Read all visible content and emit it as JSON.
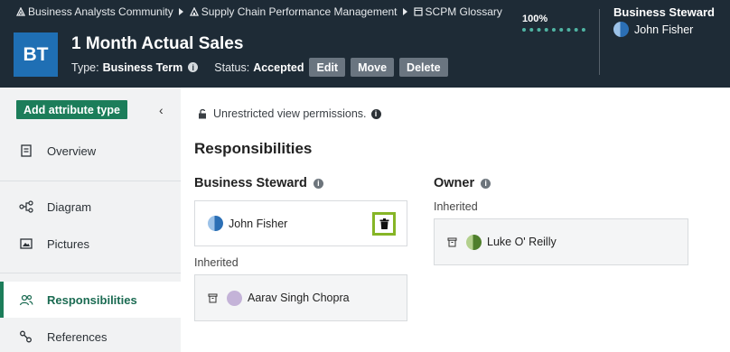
{
  "header": {
    "breadcrumbs": [
      {
        "label": "Business Analysts Community",
        "icon": "community-icon"
      },
      {
        "label": "Supply Chain Performance Management",
        "icon": "domain-icon"
      },
      {
        "label": "SCPM Glossary",
        "icon": "glossary-icon"
      }
    ],
    "asset_badge": "BT",
    "title": "1 Month Actual Sales",
    "type_label": "Type:",
    "type_value": "Business Term",
    "status_label": "Status:",
    "status_value": "Accepted",
    "buttons": {
      "edit": "Edit",
      "move": "Move",
      "delete": "Delete"
    },
    "progress": {
      "value": "100%",
      "fraction": 1.0
    },
    "steward": {
      "label": "Business Steward",
      "name": "John Fisher"
    }
  },
  "sidebar": {
    "add_attribute": "Add attribute type",
    "collapse_icon": "chevron-left-icon",
    "items": [
      {
        "label": "Overview",
        "icon": "overview-icon"
      },
      {
        "label": "Diagram",
        "icon": "diagram-icon"
      },
      {
        "label": "Pictures",
        "icon": "pictures-icon"
      },
      {
        "label": "Responsibilities",
        "icon": "people-icon",
        "active": true
      },
      {
        "label": "References",
        "icon": "references-icon"
      }
    ]
  },
  "main": {
    "permissions_text": "Unrestricted view permissions.",
    "section_title": "Responsibilities",
    "business_steward": {
      "title": "Business Steward",
      "assigned": "John Fisher",
      "inherited_label": "Inherited",
      "inherited": "Aarav Singh Chopra"
    },
    "owner": {
      "title": "Owner",
      "inherited_label": "Inherited",
      "inherited": "Luke O' Reilly"
    }
  },
  "colors": {
    "header_bg": "#1e2b36",
    "brand_badge": "#1f6fb4",
    "accent_green": "#1c7d5a",
    "highlight": "#86b526"
  }
}
